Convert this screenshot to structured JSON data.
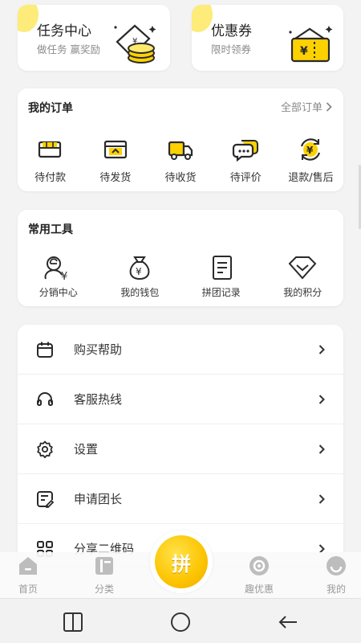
{
  "promos": {
    "task": {
      "title": "任务中心",
      "subtitle": "做任务 赢奖励",
      "icon": "coins-ticket-icon"
    },
    "coupon": {
      "title": "优惠券",
      "subtitle": "限时领券",
      "icon": "coupon-icon"
    }
  },
  "orders": {
    "title": "我的订单",
    "view_all": "全部订单",
    "items": [
      {
        "label": "待付款",
        "icon": "wallet-icon"
      },
      {
        "label": "待发货",
        "icon": "box-ship-icon"
      },
      {
        "label": "待收货",
        "icon": "truck-icon"
      },
      {
        "label": "待评价",
        "icon": "chat-bubble-icon"
      },
      {
        "label": "退款/售后",
        "icon": "refund-icon"
      }
    ]
  },
  "tools": {
    "title": "常用工具",
    "items": [
      {
        "label": "分销中心",
        "icon": "distribution-icon"
      },
      {
        "label": "我的钱包",
        "icon": "money-bag-icon"
      },
      {
        "label": "拼团记录",
        "icon": "document-icon"
      },
      {
        "label": "我的积分",
        "icon": "diamond-icon"
      }
    ]
  },
  "menu": {
    "items": [
      {
        "label": "购买帮助",
        "icon": "calendar-icon"
      },
      {
        "label": "客服热线",
        "icon": "headset-icon"
      },
      {
        "label": "设置",
        "icon": "gear-icon"
      },
      {
        "label": "申请团长",
        "icon": "edit-icon"
      },
      {
        "label": "分享二维码",
        "icon": "qr-icon"
      }
    ]
  },
  "tabbar": {
    "home": "首页",
    "category": "分类",
    "center": "拼",
    "deals": "趣优惠",
    "mine": "我的"
  },
  "colors": {
    "accent": "#fcc400",
    "accent_light": "#fde96b",
    "icon_stroke": "#2a2a2a"
  }
}
